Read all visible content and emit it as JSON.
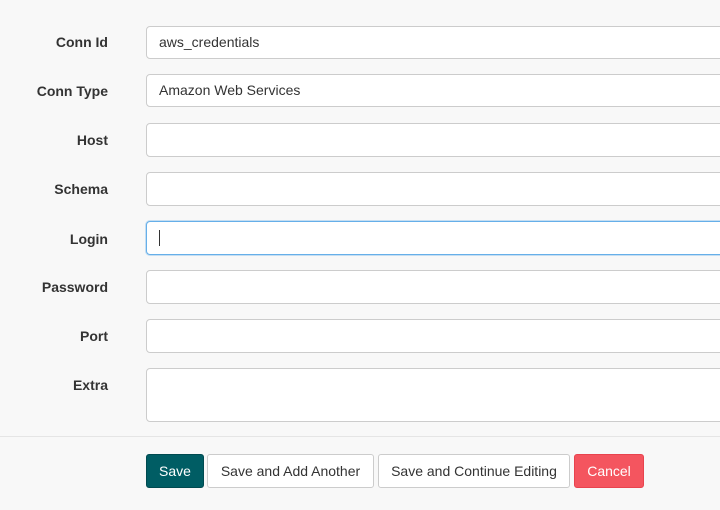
{
  "form": {
    "fields": [
      {
        "label": "Conn Id",
        "value": "aws_credentials"
      },
      {
        "label": "Conn Type",
        "value": "Amazon Web Services"
      },
      {
        "label": "Host",
        "value": ""
      },
      {
        "label": "Schema",
        "value": ""
      },
      {
        "label": "Login",
        "value": ""
      },
      {
        "label": "Password",
        "value": ""
      },
      {
        "label": "Port",
        "value": ""
      },
      {
        "label": "Extra",
        "value": ""
      }
    ]
  },
  "actions": {
    "save": "Save",
    "save_add_another": "Save and Add Another",
    "save_continue": "Save and Continue Editing",
    "cancel": "Cancel"
  },
  "colors": {
    "primary": "#005d64",
    "danger": "#f4555f",
    "focus": "#66afe9"
  }
}
